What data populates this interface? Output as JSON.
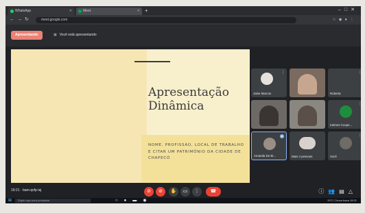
{
  "browser": {
    "tabs": [
      {
        "label": "WhatsApp"
      },
      {
        "label": "Meet"
      }
    ],
    "new_tab": "+",
    "url": "meet.google.com"
  },
  "meet": {
    "presenting_chip": "Apresentando",
    "presenting_message": "Você está apresentando"
  },
  "slide": {
    "title": "Apresentação Dinâmica",
    "body": "NOME, PROFISSÃO, LOCAL DE TRABALHO E CITAR UM PATRIMÔNIO DA CIDADE DE CHAPECÓ"
  },
  "participants": [
    {
      "name": "Jaine Marcon"
    },
    {
      "name": ""
    },
    {
      "name": "Roberta"
    },
    {
      "name": ""
    },
    {
      "name": ""
    },
    {
      "name": "Iraimes Coope..."
    },
    {
      "name": "Amanda De Bi..."
    },
    {
      "name": "Mais 4 pessoas"
    },
    {
      "name": "Você"
    }
  ],
  "bottom_bar": {
    "meeting_info": "19:21 · bam-qvfp-isj"
  },
  "taskbar": {
    "search_placeholder": "Digite aqui para pesquisar",
    "tray_text": "20°C Chuva fraca  19:21"
  },
  "colors": {
    "present_chip": "#ea8275",
    "danger": "#ea4335",
    "slide_bg": "#f6e6b4",
    "slide_box": "#f3e19a"
  }
}
